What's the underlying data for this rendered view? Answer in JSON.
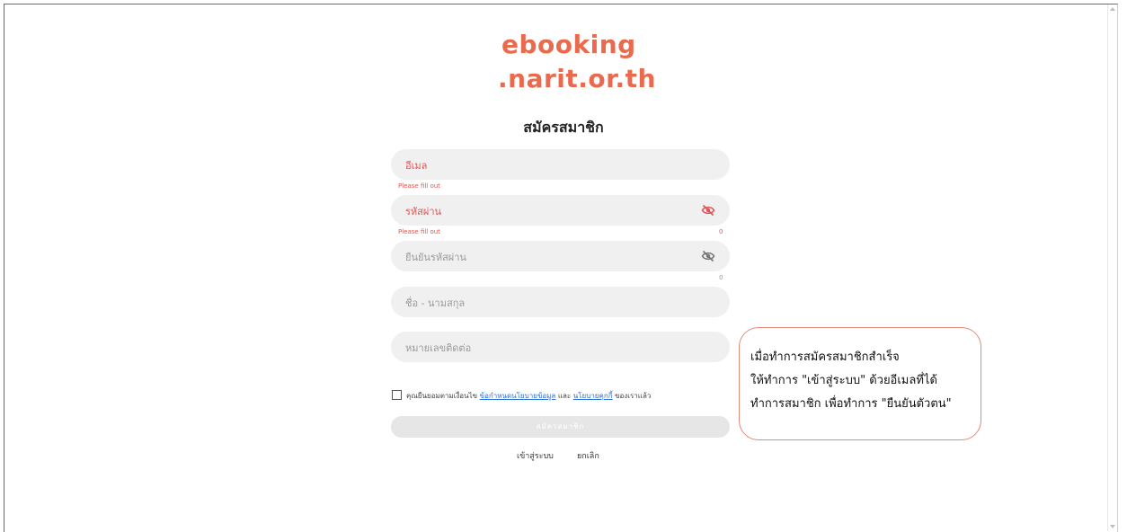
{
  "logo": {
    "line1": "ebooking",
    "line2": ".narit.or.th",
    "color": "#ea6a4e"
  },
  "page_title": "สมัครสมาชิก",
  "form": {
    "email_placeholder": "อีเมล",
    "email_error": "Please fill out",
    "password_placeholder": "รหัสผ่าน",
    "password_error": "Please fill out",
    "password_counter": "0",
    "confirm_placeholder": "ยืนยันรหัสผ่าน",
    "confirm_counter": "0",
    "name_placeholder": "ชื่อ - นามสกุล",
    "phone_placeholder": "หมายเลขติดต่อ",
    "eye_icon": "eye-off-icon"
  },
  "consent": {
    "prefix": "คุณยืนยอมตามเงื่อนไข",
    "link1": "ข้อกำหนดนโยบายข้อมูล",
    "middle": "และ",
    "link2": "นโยบายคุกกี้",
    "suffix": "ของเราแล้ว"
  },
  "submit_label": "สมัครสมาชิก",
  "links": {
    "login": "เข้าสู่ระบบ",
    "cancel": "ยกเลิก"
  },
  "callout": {
    "line1": "เมื่อทำการสมัครสมาชิกสำเร็จ",
    "line2": "ให้ทำการ \"เข้าสู่ระบบ\" ด้วยอีเมลที่ได้",
    "line3": "ทำการสมาชิก เพื่อทำการ \"ยืนยันตัวตน\"",
    "border_color": "#e48a7a"
  },
  "colors": {
    "error": "#e05555",
    "field_bg": "#f0f0f0",
    "link": "#2a6fd6"
  }
}
